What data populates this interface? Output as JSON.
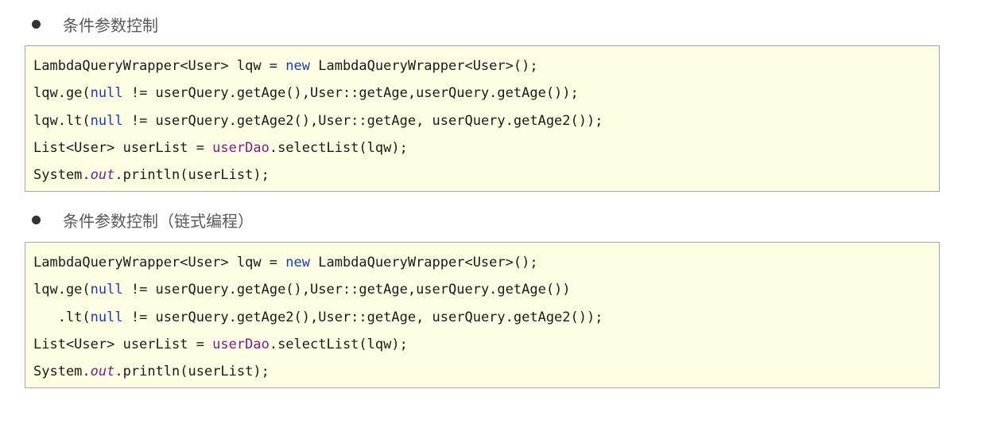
{
  "sections": [
    {
      "heading": "条件参数控制",
      "code_lines": [
        [
          {
            "t": "LambdaQueryWrapper<User> lqw = "
          },
          {
            "t": "new",
            "k": "kw"
          },
          {
            "t": " LambdaQueryWrapper<User>();"
          }
        ],
        [
          {
            "t": "lqw.ge("
          },
          {
            "t": "null",
            "k": "kw"
          },
          {
            "t": " != userQuery.getAge(),User::getAge,userQuery.getAge());"
          }
        ],
        [
          {
            "t": "lqw.lt("
          },
          {
            "t": "null",
            "k": "kw"
          },
          {
            "t": " != userQuery.getAge2(),User::getAge, userQuery.getAge2());"
          }
        ],
        [
          {
            "t": "List<User> userList = "
          },
          {
            "t": "userDao",
            "k": "fld"
          },
          {
            "t": ".selectList(lqw);"
          }
        ],
        [
          {
            "t": "System."
          },
          {
            "t": "out",
            "k": "fld-it"
          },
          {
            "t": ".println(userList);"
          }
        ]
      ]
    },
    {
      "heading": "条件参数控制（链式编程）",
      "code_lines": [
        [
          {
            "t": "LambdaQueryWrapper<User> lqw = "
          },
          {
            "t": "new",
            "k": "kw"
          },
          {
            "t": " LambdaQueryWrapper<User>();"
          }
        ],
        [
          {
            "t": "lqw.ge("
          },
          {
            "t": "null",
            "k": "kw"
          },
          {
            "t": " != userQuery.getAge(),User::getAge,userQuery.getAge())"
          }
        ],
        [
          {
            "t": "   .lt("
          },
          {
            "t": "null",
            "k": "kw"
          },
          {
            "t": " != userQuery.getAge2(),User::getAge, userQuery.getAge2());"
          }
        ],
        [
          {
            "t": "List<User> userList = "
          },
          {
            "t": "userDao",
            "k": "fld"
          },
          {
            "t": ".selectList(lqw);"
          }
        ],
        [
          {
            "t": "System."
          },
          {
            "t": "out",
            "k": "fld-it"
          },
          {
            "t": ".println(userList);"
          }
        ]
      ]
    }
  ],
  "colors": {
    "code_background": "#fefee4",
    "code_border": "#a6a6a6",
    "keyword": "#1b3fa6",
    "field": "#7a1e86",
    "heading_text": "#595959"
  }
}
